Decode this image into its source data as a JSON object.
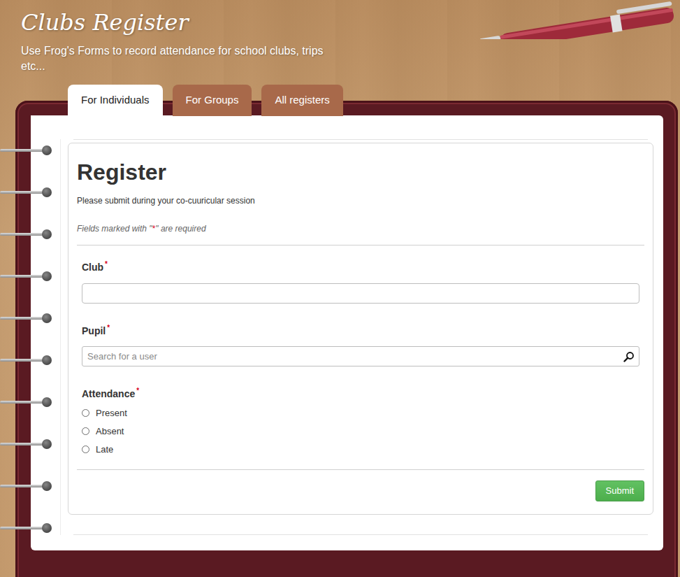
{
  "header": {
    "title": "Clubs Register",
    "subtitle": "Use Frog's Forms to record attendance for school clubs, trips etc..."
  },
  "tabs": [
    {
      "label": "For Individuals",
      "selected": true
    },
    {
      "label": "For Groups",
      "selected": false
    },
    {
      "label": "All registers",
      "selected": false
    }
  ],
  "form": {
    "title": "Register",
    "description": "Please submit during your co-cuuricular session",
    "required_note": {
      "before": "Fields marked with \"",
      "mark": "*",
      "after": "\" are required"
    },
    "required_mark": "*",
    "fields": [
      {
        "label": "Club",
        "required": true,
        "kind": "text",
        "value": ""
      },
      {
        "label": "Pupil",
        "required": true,
        "kind": "search",
        "placeholder": "Search for a user"
      },
      {
        "label": "Attendance",
        "required": true,
        "kind": "radio",
        "options": [
          {
            "label": "Present",
            "selected": false
          },
          {
            "label": "Absent",
            "selected": false
          },
          {
            "label": "Late",
            "selected": false
          }
        ]
      }
    ],
    "submit": "Submit"
  }
}
